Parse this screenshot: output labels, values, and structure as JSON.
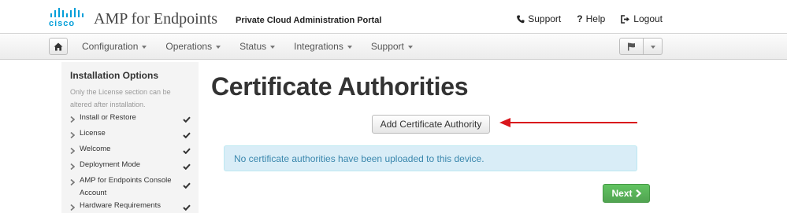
{
  "header": {
    "brand": "cisco",
    "app_title": "AMP for Endpoints",
    "subtitle": "Private Cloud Administration Portal",
    "links": [
      {
        "label": "Support",
        "icon": "phone-icon"
      },
      {
        "label": "Help",
        "icon": "question-icon"
      },
      {
        "label": "Logout",
        "icon": "logout-icon"
      }
    ]
  },
  "navbar": {
    "home_icon": "home-icon",
    "items": [
      {
        "label": "Configuration"
      },
      {
        "label": "Operations"
      },
      {
        "label": "Status"
      },
      {
        "label": "Integrations"
      },
      {
        "label": "Support"
      }
    ],
    "flag_icon": "flag-icon"
  },
  "sidebar": {
    "title": "Installation Options",
    "note": "Only the License section can be altered after installation.",
    "items": [
      {
        "label": "Install or Restore",
        "done": true
      },
      {
        "label": "License",
        "done": true
      },
      {
        "label": "Welcome",
        "done": true
      },
      {
        "label": "Deployment Mode",
        "done": true
      },
      {
        "label": "AMP for Endpoints Console Account",
        "done": true
      },
      {
        "label": "Hardware Requirements",
        "done": true
      }
    ]
  },
  "main": {
    "title": "Certificate Authorities",
    "add_button": "Add Certificate Authority",
    "alert": "No certificate authorities have been uploaded to this device.",
    "next_button": "Next"
  },
  "colors": {
    "brand": "#049fd9",
    "alert_bg": "#d9edf7",
    "alert_text": "#3a87ad",
    "next_bg": "#5bb75b",
    "annotation_arrow": "#d9161c"
  }
}
